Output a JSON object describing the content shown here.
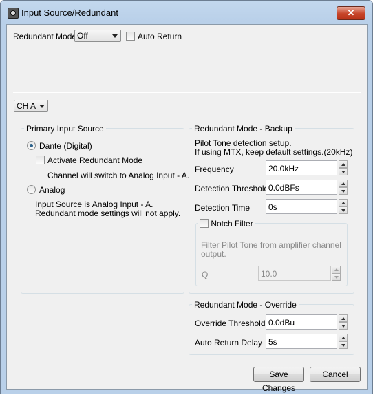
{
  "window": {
    "title": "Input Source/Redundant",
    "close_label": "✕"
  },
  "top": {
    "redundant_mode_label": "Redundant Mode",
    "redundant_mode_value": "Off",
    "auto_return_label": "Auto Return",
    "auto_return_checked": false
  },
  "channel": {
    "value": "CH A"
  },
  "primary": {
    "title": "Primary Input Source",
    "dante_label": "Dante (Digital)",
    "dante_selected": true,
    "activate_label": "Activate Redundant Mode",
    "activate_note": "Channel will switch to Analog Input - A.",
    "analog_label": "Analog",
    "analog_note_1": "Input Source is Analog Input - A.",
    "analog_note_2": "Redundant mode settings will not apply."
  },
  "backup": {
    "title": "Redundant Mode - Backup",
    "desc_1": "Pilot Tone detection setup.",
    "desc_2": "If using MTX, keep default settings.(20kHz)",
    "frequency_label": "Frequency",
    "frequency_value": "20.0kHz",
    "threshold_label": "Detection Threshold",
    "threshold_value": "0.0dBFs",
    "time_label": "Detection Time",
    "time_value": "0s",
    "notch_label": "Notch Filter",
    "notch_desc_1": "Filter Pilot Tone from amplifier channel",
    "notch_desc_2": "output.",
    "q_label": "Q",
    "q_value": "10.0"
  },
  "override": {
    "title": "Redundant Mode - Override",
    "threshold_label": "Override Threshold",
    "threshold_value": "0.0dBu",
    "delay_label": "Auto Return Delay",
    "delay_value": "5s"
  },
  "footer": {
    "save_label": "Save Changes",
    "cancel_label": "Cancel"
  }
}
